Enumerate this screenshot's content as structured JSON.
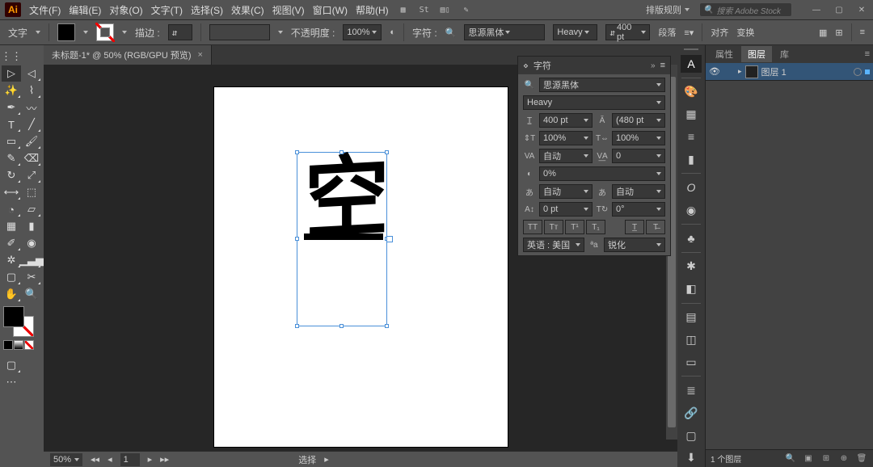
{
  "menu": {
    "items": [
      "文件(F)",
      "编辑(E)",
      "对象(O)",
      "文字(T)",
      "选择(S)",
      "效果(C)",
      "视图(V)",
      "窗口(W)",
      "帮助(H)"
    ],
    "workspace": "排版规则",
    "search_placeholder": "搜索 Adobe Stock"
  },
  "options": {
    "tool_label": "文字",
    "stroke_label": "描边 :",
    "opacity_label": "不透明度 :",
    "opacity_value": "100%",
    "char_label": "字符 :",
    "font_family": "思源黑体",
    "font_weight": "Heavy",
    "font_size": "400 pt",
    "align_btn": "段落",
    "align_label": "对齐",
    "transform_label": "变换"
  },
  "document": {
    "tab_title": "未标题-1* @ 50% (RGB/GPU 预览)",
    "glyph": "空",
    "zoom": "50%",
    "artboard_nav": "1",
    "status_tool": "选择"
  },
  "char_panel": {
    "title": "字符",
    "font_family": "思源黑体",
    "font_weight": "Heavy",
    "size": "400 pt",
    "leading": "(480 pt",
    "vscale": "100%",
    "hscale": "100%",
    "kerning": "自动",
    "tracking": "0",
    "opacity": "0%",
    "auto1": "自动",
    "auto2": "自动",
    "baseline": "0 pt",
    "rotation": "0°",
    "language": "英语 : 美国",
    "aa_label": "锐化"
  },
  "layers": {
    "tabs": [
      "属性",
      "图层",
      "库"
    ],
    "active_tab": 1,
    "layer_name": "图层 1",
    "footer_count": "1 个图层"
  },
  "dock": {
    "groups": [
      [
        "character"
      ],
      [
        "color",
        "swatches",
        "stroke",
        "gradient"
      ],
      [
        "transparency",
        "appearance"
      ],
      [
        "symbols"
      ],
      [
        "brushes",
        "graphic-styles"
      ],
      [
        "align",
        "pathfinder",
        "transform"
      ],
      [
        "actions",
        "links",
        "artboards",
        "asset-export"
      ]
    ]
  }
}
